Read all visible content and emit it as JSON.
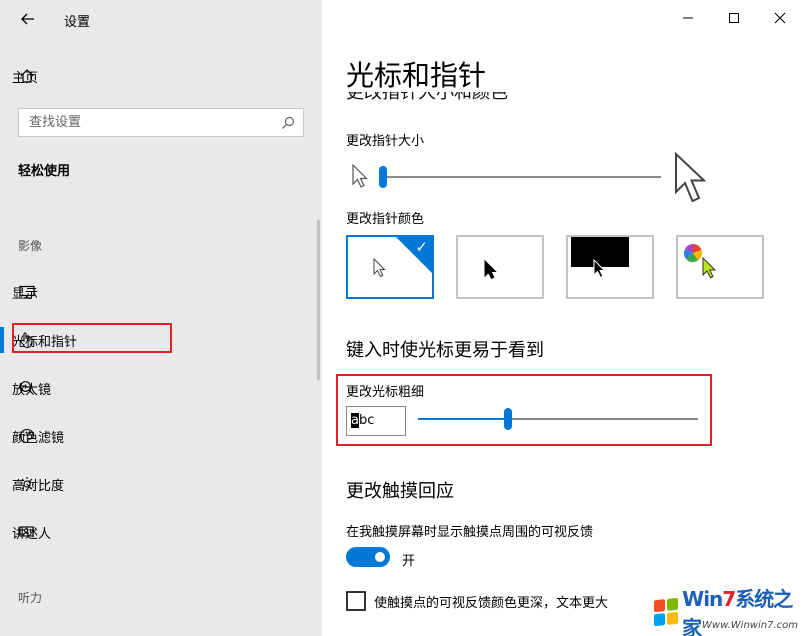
{
  "window": {
    "app_title": "设置",
    "back_label": "←",
    "minimize_label": "—",
    "maximize_label": "☐",
    "close_label": "✕"
  },
  "sidebar": {
    "home_label": "主页",
    "search_placeholder": "查找设置",
    "section_title": "轻松使用",
    "group_vision": "影像",
    "group_hearing": "听力",
    "items": [
      {
        "label": "显示",
        "icon": "monitor-icon"
      },
      {
        "label": "光标和指针",
        "icon": "pointer-hand-icon",
        "active": true
      },
      {
        "label": "放大镜",
        "icon": "magnifier-icon"
      },
      {
        "label": "颜色滤镜",
        "icon": "palette-icon"
      },
      {
        "label": "高对比度",
        "icon": "brightness-icon"
      },
      {
        "label": "讲述人",
        "icon": "narrator-icon"
      }
    ]
  },
  "main": {
    "page_title": "光标和指针",
    "partial_heading": "更改指针大小和颜色",
    "pointer_size_label": "更改指针大小",
    "pointer_size_level": 0.06,
    "pointer_color_label": "更改指针颜色",
    "pointer_color_options": [
      "white",
      "black",
      "inverted",
      "custom"
    ],
    "pointer_color_selected": "white",
    "cursor_heading": "键入时使光标更易于看到",
    "cursor_thickness_label": "更改光标粗细",
    "cursor_preview_first": "a",
    "cursor_preview_rest": "bc",
    "cursor_thickness_level": 0.32,
    "touch_heading": "更改触摸回应",
    "touch_feedback_label": "在我触摸屏幕时显示触摸点周围的可视反馈",
    "toggle_state": "开",
    "toggle_on": true,
    "darker_feedback_label": "使触摸点的可视反馈颜色更深，文本更大",
    "darker_feedback_checked": false
  },
  "watermark": {
    "brand_prefix": "Win",
    "brand_digit": "7",
    "brand_cn": "系统之家",
    "sub": "Www.Winwin7.com"
  },
  "colors": {
    "accent": "#0078d7",
    "sidebar_bg": "#e9e9e9",
    "highlight": "#e0202c"
  }
}
